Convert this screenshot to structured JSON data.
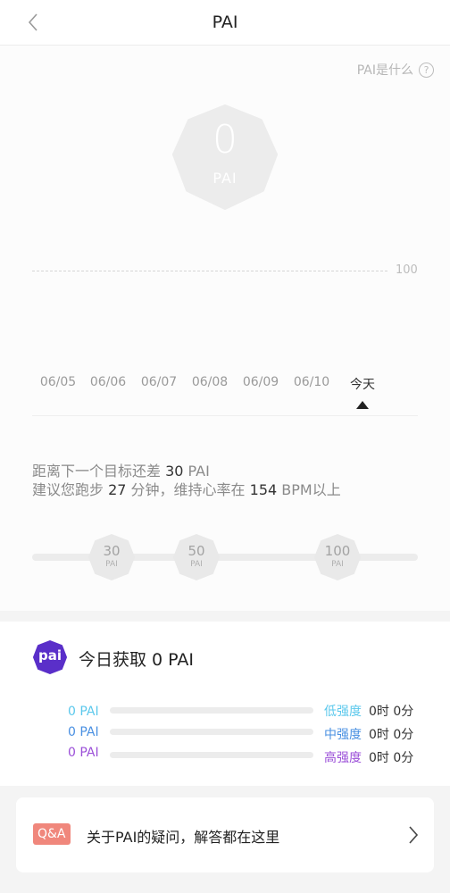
{
  "header": {
    "title": "PAI"
  },
  "help": {
    "label": "PAI是什么",
    "icon_glyph": "?"
  },
  "badge": {
    "value": "0",
    "unit": "PAI"
  },
  "chart": {
    "goal_label": "100",
    "days": [
      "06/05",
      "06/06",
      "06/07",
      "06/08",
      "06/09",
      "06/10",
      "今天"
    ]
  },
  "advice": {
    "line1_prefix": "距离下一个目标还差 ",
    "line1_value": "30",
    "line1_suffix": " PAI",
    "line2_prefix": "建议您跑步 ",
    "line2_minutes": "27",
    "line2_mid": " 分钟，维持心率在 ",
    "line2_bpm": "154",
    "line2_suffix": " BPM以上"
  },
  "milestones": [
    {
      "value": "30",
      "unit": "PAI"
    },
    {
      "value": "50",
      "unit": "PAI"
    },
    {
      "value": "100",
      "unit": "PAI"
    }
  ],
  "progress": {
    "current": 0,
    "max": 100
  },
  "today": {
    "logo_text": "pai",
    "title": "今日获取 0 PAI",
    "rows": [
      {
        "pai": "0 PAI",
        "level": "低强度",
        "time": "0时 0分",
        "color": "#5bc8ec",
        "fill": 0
      },
      {
        "pai": "0 PAI",
        "level": "中强度",
        "time": "0时 0分",
        "color": "#4a90e2",
        "fill": 0
      },
      {
        "pai": "0 PAI",
        "level": "高强度",
        "time": "0时 0分",
        "color": "#9b4fd8",
        "fill": 0
      }
    ]
  },
  "qa": {
    "tag": "Q&A",
    "text": "关于PAI的疑问，解答都在这里"
  },
  "colors": {
    "brand_purple": "#5a2fc9",
    "qa_tag": "#f0877c",
    "badge_fill": "#ececec"
  }
}
